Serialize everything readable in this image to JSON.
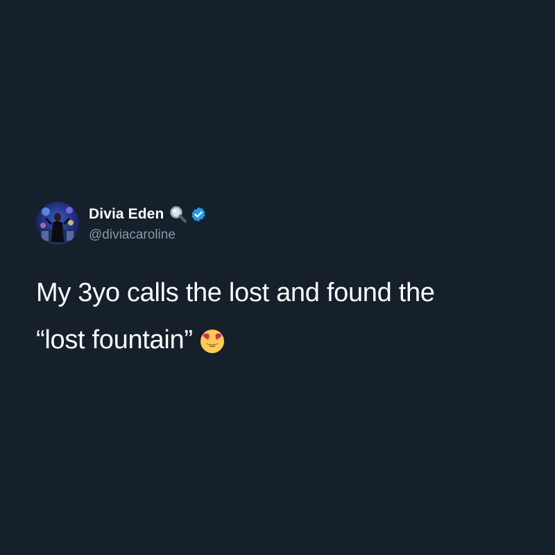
{
  "tweet": {
    "author": {
      "display_name": "Divia Eden",
      "handle": "@diviacaroline",
      "avatar": "profile-photo",
      "name_icons": [
        "magnifying-glass-icon",
        "verified-badge-icon"
      ]
    },
    "text_lines": [
      "My 3yo calls the lost and found the",
      "“lost fountain”"
    ],
    "emoji": "smiling-face-with-heart-eyes-icon"
  },
  "colors": {
    "background": "#15202b",
    "text_primary": "#ffffff",
    "text_secondary": "#8b98a5",
    "verified_blue": "#1d9bf0"
  }
}
